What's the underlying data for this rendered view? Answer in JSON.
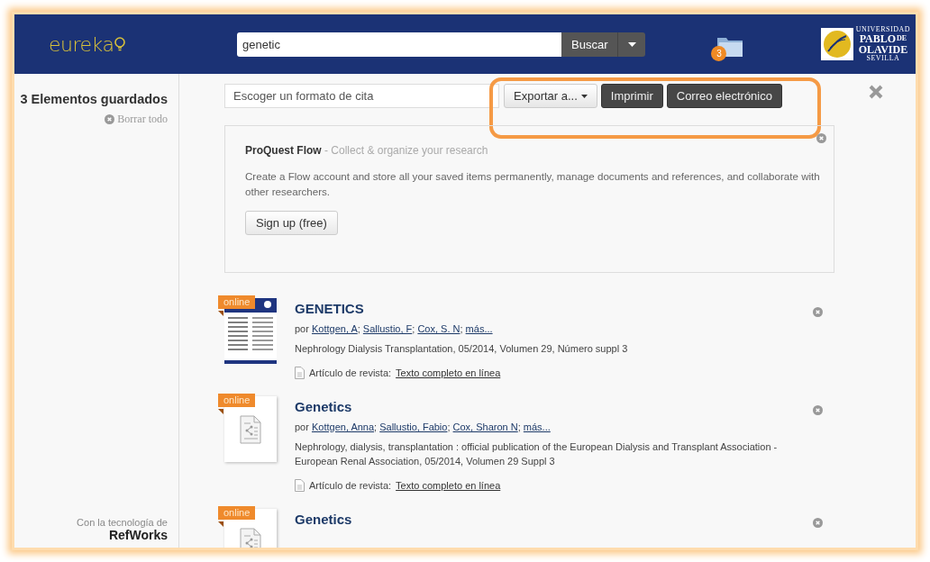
{
  "header": {
    "logo": "eureka",
    "search": {
      "value": "genetic"
    },
    "search_button": "Buscar",
    "saved_count": "3",
    "university_logo": {
      "top": "UNIVERSIDAD",
      "name_1": "PABLO",
      "joiner": "DE",
      "name_2": "OLAVIDE",
      "city": "SEVILLA"
    }
  },
  "sidebar": {
    "title": "3 Elementos guardados",
    "clear_all": "Borrar todo",
    "powered_by": "Con la tecnología de",
    "brand": "RefWorks"
  },
  "toolbar": {
    "citation_placeholder": "Escoger un formato de cita",
    "export": "Exportar a...",
    "print": "Imprimir",
    "email": "Correo electrónico"
  },
  "flow_panel": {
    "title": "ProQuest Flow",
    "tagline": "- Collect & organize your research",
    "text": "Create a Flow account and store all your saved items permanently, manage documents and references, and collaborate with other researchers.",
    "button": "Sign up (free)"
  },
  "items": [
    {
      "kind": "cover",
      "badge": "online",
      "title": "GENETICS",
      "by": "por",
      "authors": [
        {
          "name": "Kottgen, A",
          "sep": ";"
        },
        {
          "name": "Sallustio, F",
          "sep": ";"
        },
        {
          "name": "Cox, S. N",
          "sep": ";"
        },
        {
          "name": "más..."
        }
      ],
      "source": "Nephrology Dialysis Transplantation, 05/2014, Volumen 29, Número suppl 3",
      "type": "Artículo de revista:",
      "link": "Texto completo en línea"
    },
    {
      "kind": "document",
      "badge": "online",
      "title": "Genetics",
      "by": "por",
      "authors": [
        {
          "name": "Kottgen, Anna",
          "sep": ";"
        },
        {
          "name": "Sallustio, Fabio",
          "sep": ";"
        },
        {
          "name": "Cox, Sharon N",
          "sep": ";"
        },
        {
          "name": "más..."
        }
      ],
      "source": "Nephrology, dialysis, transplantation : official publication of the European Dialysis and Transplant Association - European Renal Association, 05/2014, Volumen 29 Suppl 3",
      "type": "Artículo de revista:",
      "link": "Texto completo en línea"
    },
    {
      "kind": "document",
      "badge": "online",
      "title": "Genetics"
    }
  ]
}
